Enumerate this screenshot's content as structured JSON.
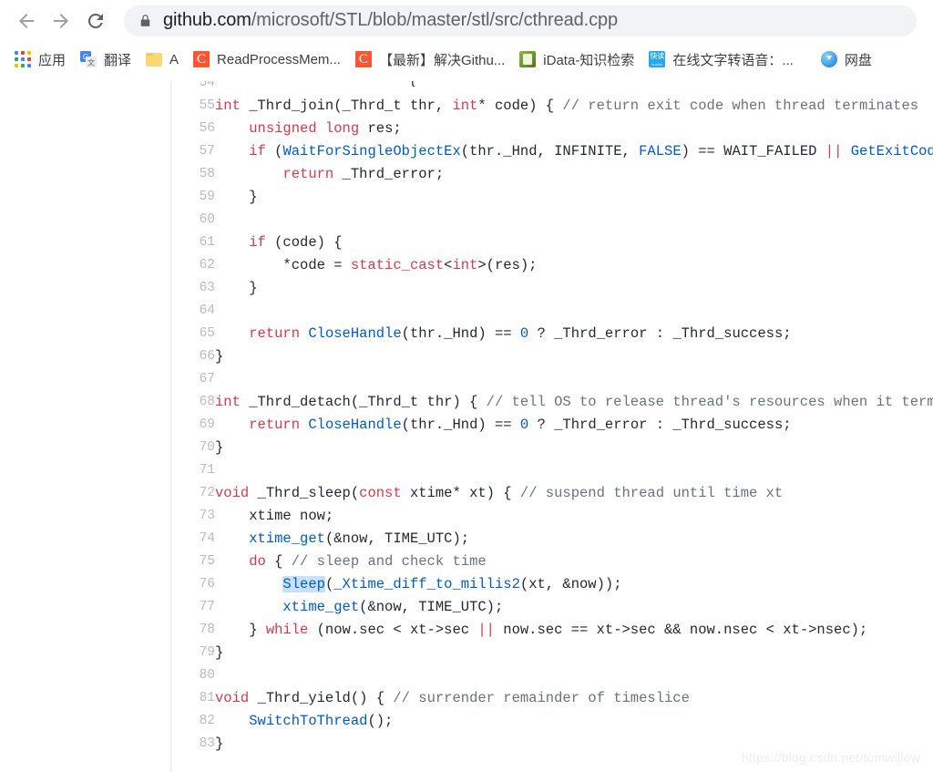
{
  "browser": {
    "back_label": "Back",
    "forward_label": "Forward",
    "reload_label": "Reload",
    "lock_icon": "lock-icon",
    "url_host": "github.com",
    "url_path": "/microsoft/STL/blob/master/stl/src/cthread.cpp",
    "url_full": "github.com/microsoft/STL/blob/master/stl/src/cthread.cpp"
  },
  "bookmarks": [
    {
      "label": "应用",
      "icon": "apps-grid-icon"
    },
    {
      "label": "翻译",
      "icon": "google-translate-icon"
    },
    {
      "label": "A",
      "icon": "folder-icon"
    },
    {
      "label": "ReadProcessMem...",
      "icon": "csdn-icon"
    },
    {
      "label": "【最新】解决Githu...",
      "icon": "csdn-icon"
    },
    {
      "label": "iData-知识检索",
      "icon": "idata-icon"
    },
    {
      "label": "在线文字转语音：...",
      "icon": "kuaidu-icon"
    },
    {
      "label": "网盘",
      "icon": "baidu-pan-icon"
    }
  ],
  "code": {
    "language": "cpp",
    "file": "cthread.cpp",
    "partial_top_line": "}",
    "lines": [
      {
        "n": "54",
        "tokens": []
      },
      {
        "n": "55",
        "tokens": [
          {
            "t": "int",
            "c": "k"
          },
          {
            "t": " _Thrd_join(",
            "c": "pl"
          },
          {
            "t": "_Thrd_t",
            "c": "pl"
          },
          {
            "t": " thr, ",
            "c": "pl"
          },
          {
            "t": "int",
            "c": "k"
          },
          {
            "t": "* code) { ",
            "c": "pl"
          },
          {
            "t": "// return exit code when thread terminates",
            "c": "cm"
          }
        ]
      },
      {
        "n": "56",
        "tokens": [
          {
            "t": "    ",
            "c": "pl"
          },
          {
            "t": "unsigned",
            "c": "k"
          },
          {
            "t": " ",
            "c": "pl"
          },
          {
            "t": "long",
            "c": "k"
          },
          {
            "t": " res;",
            "c": "pl"
          }
        ]
      },
      {
        "n": "57",
        "tokens": [
          {
            "t": "    ",
            "c": "pl"
          },
          {
            "t": "if",
            "c": "k"
          },
          {
            "t": " (",
            "c": "pl"
          },
          {
            "t": "WaitForSingleObjectEx",
            "c": "fn"
          },
          {
            "t": "(thr._Hnd, INFINITE, ",
            "c": "pl"
          },
          {
            "t": "FALSE",
            "c": "cn"
          },
          {
            "t": ") == WAIT_FAILED ",
            "c": "pl"
          },
          {
            "t": "||",
            "c": "k"
          },
          {
            "t": " ",
            "c": "pl"
          },
          {
            "t": "GetExitCodeThread",
            "c": "fn"
          },
          {
            "t": "(",
            "c": "pl"
          }
        ]
      },
      {
        "n": "58",
        "tokens": [
          {
            "t": "        ",
            "c": "pl"
          },
          {
            "t": "return",
            "c": "k"
          },
          {
            "t": " _Thrd_error;",
            "c": "pl"
          }
        ]
      },
      {
        "n": "59",
        "tokens": [
          {
            "t": "    }",
            "c": "pl"
          }
        ]
      },
      {
        "n": "60",
        "tokens": []
      },
      {
        "n": "61",
        "tokens": [
          {
            "t": "    ",
            "c": "pl"
          },
          {
            "t": "if",
            "c": "k"
          },
          {
            "t": " (code) {",
            "c": "pl"
          }
        ]
      },
      {
        "n": "62",
        "tokens": [
          {
            "t": "        *code = ",
            "c": "pl"
          },
          {
            "t": "static_cast",
            "c": "k"
          },
          {
            "t": "<",
            "c": "pl"
          },
          {
            "t": "int",
            "c": "k"
          },
          {
            "t": ">(res);",
            "c": "pl"
          }
        ]
      },
      {
        "n": "63",
        "tokens": [
          {
            "t": "    }",
            "c": "pl"
          }
        ]
      },
      {
        "n": "64",
        "tokens": []
      },
      {
        "n": "65",
        "tokens": [
          {
            "t": "    ",
            "c": "pl"
          },
          {
            "t": "return",
            "c": "k"
          },
          {
            "t": " ",
            "c": "pl"
          },
          {
            "t": "CloseHandle",
            "c": "fn"
          },
          {
            "t": "(thr._Hnd) == ",
            "c": "pl"
          },
          {
            "t": "0",
            "c": "num"
          },
          {
            "t": " ? _Thrd_error : _Thrd_success;",
            "c": "pl"
          }
        ]
      },
      {
        "n": "66",
        "tokens": [
          {
            "t": "}",
            "c": "pl"
          }
        ]
      },
      {
        "n": "67",
        "tokens": []
      },
      {
        "n": "68",
        "tokens": [
          {
            "t": "int",
            "c": "k"
          },
          {
            "t": " _Thrd_detach(_Thrd_t thr) { ",
            "c": "pl"
          },
          {
            "t": "// tell OS to release thread's resources when it terminates",
            "c": "cm"
          }
        ]
      },
      {
        "n": "69",
        "tokens": [
          {
            "t": "    ",
            "c": "pl"
          },
          {
            "t": "return",
            "c": "k"
          },
          {
            "t": " ",
            "c": "pl"
          },
          {
            "t": "CloseHandle",
            "c": "fn"
          },
          {
            "t": "(thr._Hnd) == ",
            "c": "pl"
          },
          {
            "t": "0",
            "c": "num"
          },
          {
            "t": " ? _Thrd_error : _Thrd_success;",
            "c": "pl"
          }
        ]
      },
      {
        "n": "70",
        "tokens": [
          {
            "t": "}",
            "c": "pl"
          }
        ]
      },
      {
        "n": "71",
        "tokens": []
      },
      {
        "n": "72",
        "tokens": [
          {
            "t": "void",
            "c": "k"
          },
          {
            "t": " _Thrd_sleep(",
            "c": "pl"
          },
          {
            "t": "const",
            "c": "k"
          },
          {
            "t": " xtime* xt) { ",
            "c": "pl"
          },
          {
            "t": "// suspend thread until time xt",
            "c": "cm"
          }
        ]
      },
      {
        "n": "73",
        "tokens": [
          {
            "t": "    xtime now;",
            "c": "pl"
          }
        ]
      },
      {
        "n": "74",
        "tokens": [
          {
            "t": "    ",
            "c": "pl"
          },
          {
            "t": "xtime_get",
            "c": "fn"
          },
          {
            "t": "(&now, TIME_UTC);",
            "c": "pl"
          }
        ]
      },
      {
        "n": "75",
        "tokens": [
          {
            "t": "    ",
            "c": "pl"
          },
          {
            "t": "do",
            "c": "k"
          },
          {
            "t": " { ",
            "c": "pl"
          },
          {
            "t": "// sleep and check time",
            "c": "cm"
          }
        ]
      },
      {
        "n": "76",
        "tokens": [
          {
            "t": "        ",
            "c": "pl"
          },
          {
            "t": "Sleep",
            "c": "fn sel"
          },
          {
            "t": "(",
            "c": "pl"
          },
          {
            "t": "_Xtime_diff_to_millis2",
            "c": "fn"
          },
          {
            "t": "(xt, &now));",
            "c": "pl"
          }
        ]
      },
      {
        "n": "77",
        "tokens": [
          {
            "t": "        ",
            "c": "pl"
          },
          {
            "t": "xtime_get",
            "c": "fn"
          },
          {
            "t": "(&now, TIME_UTC);",
            "c": "pl"
          }
        ]
      },
      {
        "n": "78",
        "tokens": [
          {
            "t": "    } ",
            "c": "pl"
          },
          {
            "t": "while",
            "c": "k"
          },
          {
            "t": " (now.sec < xt->sec ",
            "c": "pl"
          },
          {
            "t": "||",
            "c": "k"
          },
          {
            "t": " now.sec == xt->sec && now.nsec < xt->nsec);",
            "c": "pl"
          }
        ]
      },
      {
        "n": "79",
        "tokens": [
          {
            "t": "}",
            "c": "pl"
          }
        ]
      },
      {
        "n": "80",
        "tokens": []
      },
      {
        "n": "81",
        "tokens": [
          {
            "t": "void",
            "c": "k"
          },
          {
            "t": " _Thrd_yield() { ",
            "c": "pl"
          },
          {
            "t": "// surrender remainder of timeslice",
            "c": "cm"
          }
        ]
      },
      {
        "n": "82",
        "tokens": [
          {
            "t": "    ",
            "c": "pl"
          },
          {
            "t": "SwitchToThread",
            "c": "fn"
          },
          {
            "t": "();",
            "c": "pl"
          }
        ]
      },
      {
        "n": "83",
        "tokens": [
          {
            "t": "}",
            "c": "pl"
          }
        ]
      }
    ]
  },
  "watermark": "https://blog.csdn.net/tomwillow",
  "colors": {
    "keyword": "#d73a49",
    "function": "#005cc5",
    "comment": "#6a737d",
    "plain": "#24292e",
    "selection": "#c8e1ff",
    "line_number": "#babbc0",
    "omnibox_bg": "#f1f3f4"
  }
}
